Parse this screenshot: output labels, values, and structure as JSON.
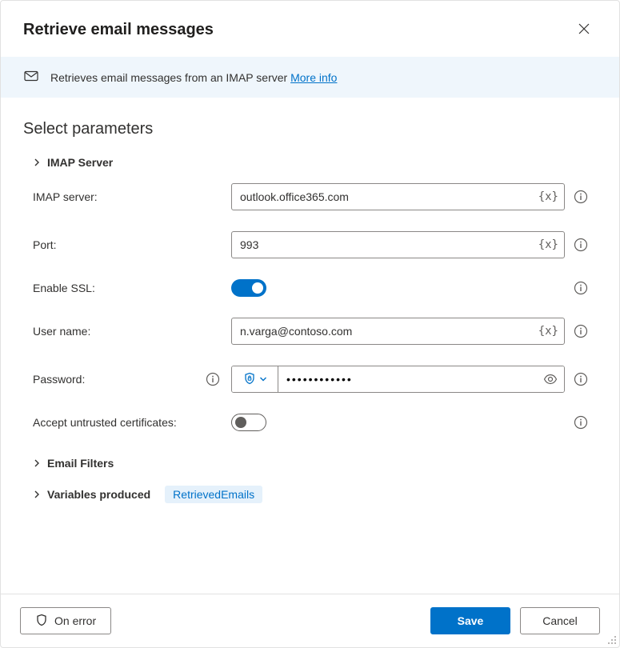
{
  "header": {
    "title": "Retrieve email messages"
  },
  "banner": {
    "description_prefix": "Retrieves email messages from an IMAP server ",
    "more_info": "More info"
  },
  "section_title": "Select parameters",
  "groups": {
    "imap_server": {
      "label": "IMAP Server",
      "expanded": true,
      "fields": {
        "server": {
          "label": "IMAP server:",
          "value": "outlook.office365.com"
        },
        "port": {
          "label": "Port:",
          "value": "993"
        },
        "enable_ssl": {
          "label": "Enable SSL:",
          "value": true
        },
        "username": {
          "label": "User name:",
          "value": "n.varga@contoso.com"
        },
        "password": {
          "label": "Password:",
          "value": "●●●●●●●●●●●●"
        },
        "accept_untrusted": {
          "label": "Accept untrusted certificates:",
          "value": false
        }
      }
    },
    "email_filters": {
      "label": "Email Filters",
      "expanded": false
    },
    "variables_produced": {
      "label": "Variables produced",
      "expanded": false,
      "pill": "RetrievedEmails"
    }
  },
  "footer": {
    "on_error": "On error",
    "save": "Save",
    "cancel": "Cancel"
  }
}
